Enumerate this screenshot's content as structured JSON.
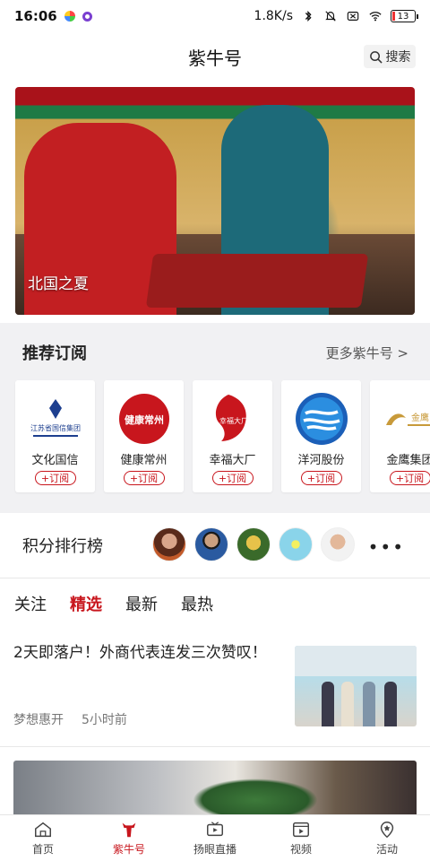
{
  "status_bar": {
    "time": "16:06",
    "speed": "1.8K/s",
    "battery": "13"
  },
  "header": {
    "title": "紫牛号",
    "search_label": "搜索"
  },
  "banner": {
    "caption": "北国之夏"
  },
  "recommend": {
    "title": "推荐订阅",
    "more": "更多紫牛号 >",
    "subscribe_label": "+订阅",
    "cards": [
      {
        "name": "文化国信",
        "logo_text": "江苏省国信集团"
      },
      {
        "name": "健康常州",
        "logo_text": "健康常州"
      },
      {
        "name": "幸福大厂",
        "logo_text": "幸福大厂"
      },
      {
        "name": "洋河股份",
        "logo_text": ""
      },
      {
        "name": "金鹰集团",
        "logo_text": "金鹰"
      }
    ]
  },
  "ranking": {
    "title": "积分排行榜",
    "more": "•••"
  },
  "tabs": [
    "关注",
    "精选",
    "最新",
    "最热"
  ],
  "active_tab": "精选",
  "article": {
    "title": "2天即落户！外商代表连发三次赞叹！",
    "author": "梦想惠开",
    "time": "5小时前"
  },
  "bottom_nav": [
    {
      "label": "首页",
      "icon": "home-icon"
    },
    {
      "label": "紫牛号",
      "icon": "ziniu-icon"
    },
    {
      "label": "扬眼直播",
      "icon": "live-icon"
    },
    {
      "label": "视频",
      "icon": "video-icon"
    },
    {
      "label": "活动",
      "icon": "activity-icon"
    }
  ],
  "colors": {
    "accent": "#c8161d",
    "section_bg": "#f1f1f3"
  }
}
